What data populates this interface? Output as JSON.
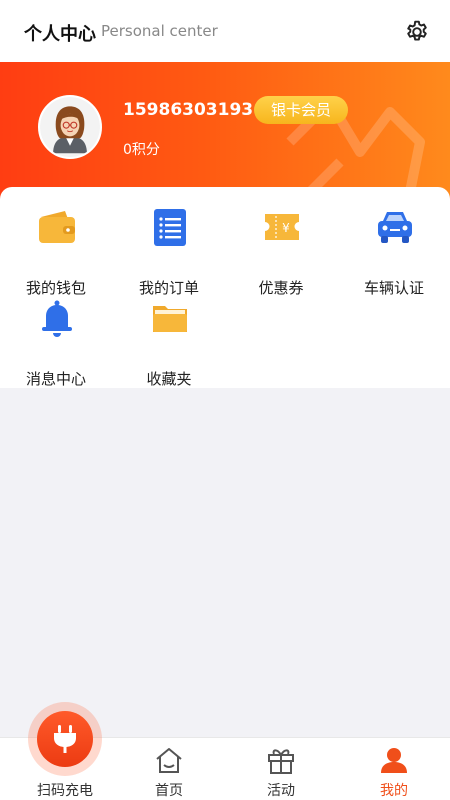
{
  "header": {
    "title": "个人中心",
    "subtitle": "Personal center",
    "settings_icon": "gear-icon"
  },
  "profile": {
    "phone": "15986303193",
    "member_level": "银卡会员",
    "points": "0积分",
    "accent_color": "#ff4a12"
  },
  "menu": {
    "items": [
      {
        "label": "我的钱包",
        "icon": "wallet-icon"
      },
      {
        "label": "我的订单",
        "icon": "order-list-icon"
      },
      {
        "label": "优惠券",
        "icon": "coupon-icon"
      },
      {
        "label": "车辆认证",
        "icon": "car-icon"
      },
      {
        "label": "消息中心",
        "icon": "bell-icon"
      },
      {
        "label": "收藏夹",
        "icon": "folder-icon"
      }
    ]
  },
  "tabbar": {
    "scan_label": "扫码充电",
    "home_label": "首页",
    "activity_label": "活动",
    "mine_label": "我的",
    "active_tab": "我的"
  }
}
